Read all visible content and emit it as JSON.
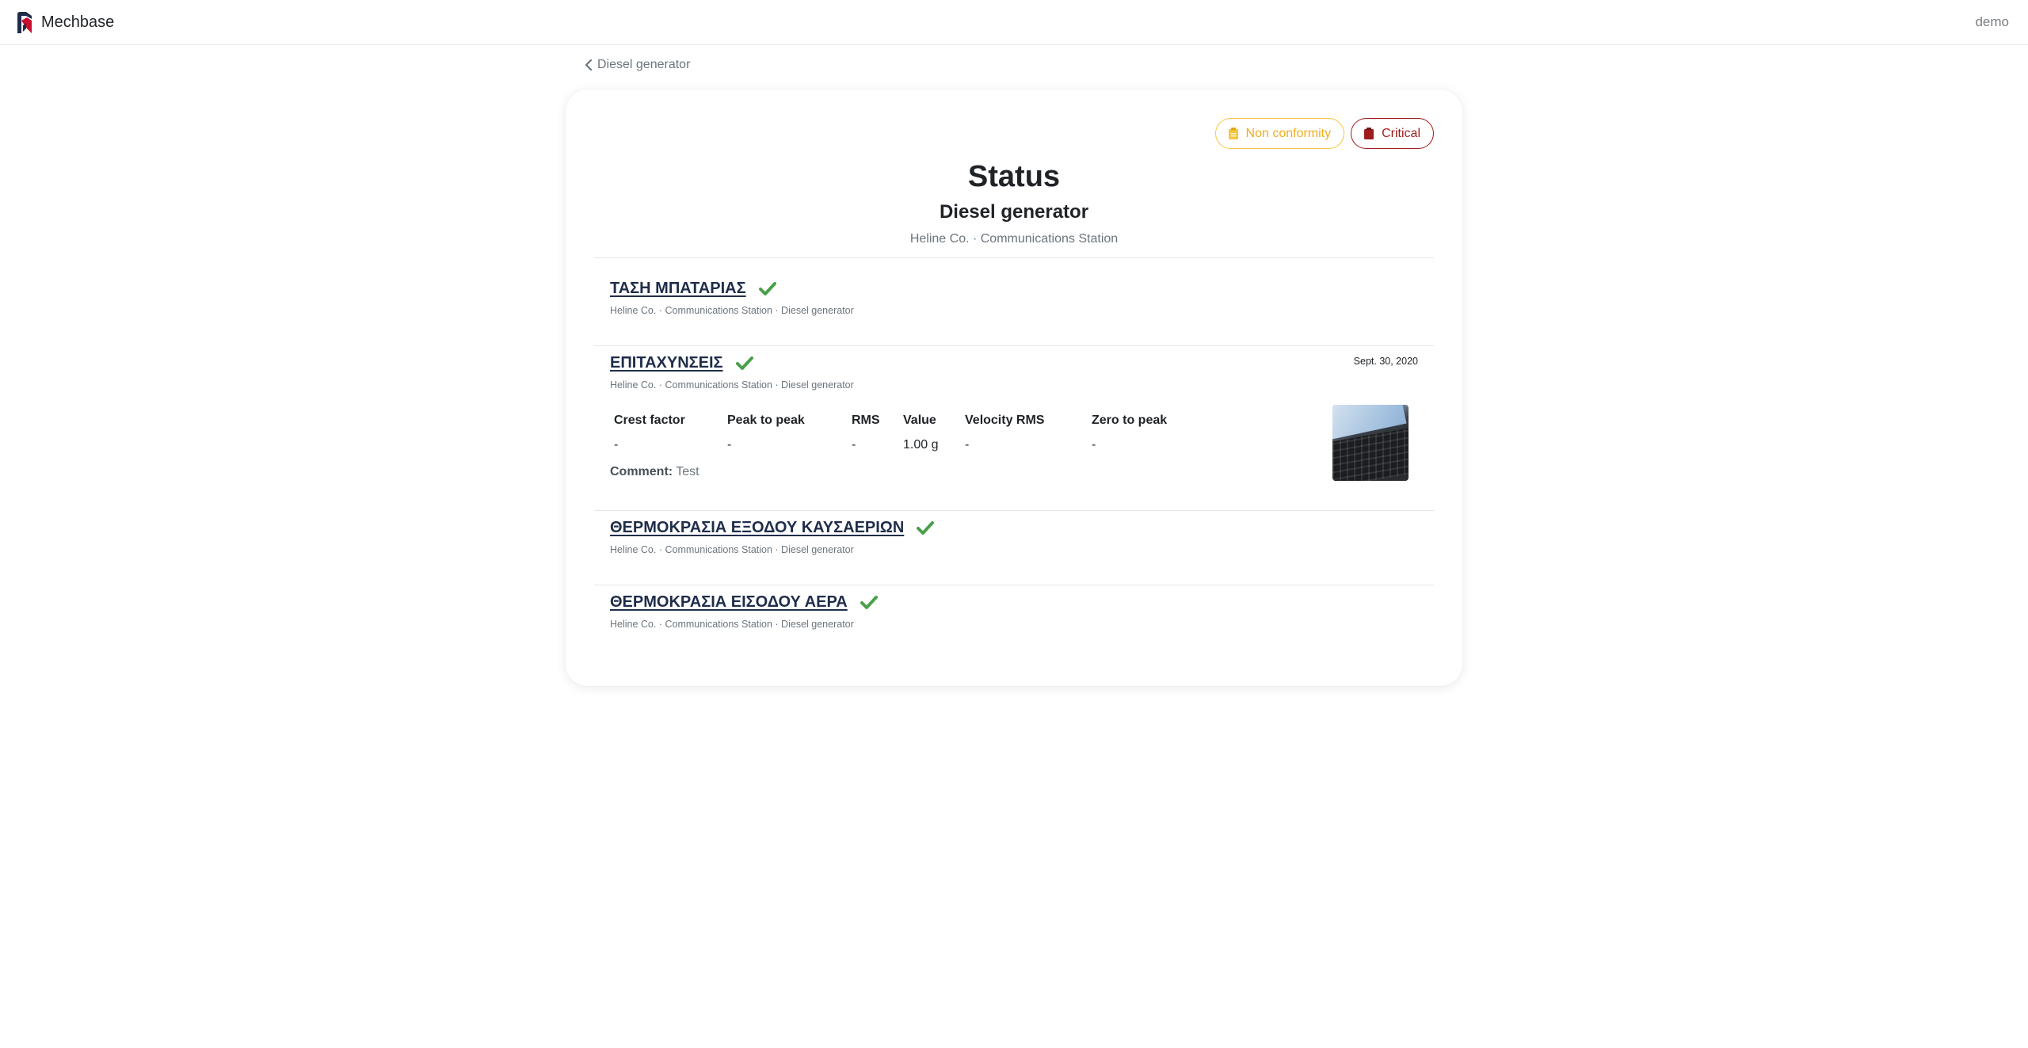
{
  "navbar": {
    "brand": "Mechbase",
    "user": "demo"
  },
  "breadcrumb": {
    "back_label": "Diesel generator"
  },
  "badges": {
    "non_conformity": "Non conformity",
    "critical": "Critical"
  },
  "header": {
    "title": "Status",
    "subtitle": "Diesel generator",
    "location": "Heline Co. · Communications Station"
  },
  "items": [
    {
      "title": "ΤΑΣΗ ΜΠΑΤΑΡΙΑΣ",
      "path": "Heline Co. · Communications Station · Diesel generator",
      "status": "ok"
    },
    {
      "title": "ΕΠΙΤΑΧΥΝΣΕΙΣ",
      "path": "Heline Co. · Communications Station · Diesel generator",
      "status": "ok",
      "date": "Sept. 30, 2020",
      "table": {
        "headers": [
          "Crest factor",
          "Peak to peak",
          "RMS",
          "Value",
          "Velocity RMS",
          "Zero to peak"
        ],
        "row": [
          "-",
          "-",
          "-",
          "1.00 g",
          "-",
          "-"
        ]
      },
      "comment_label": "Comment:",
      "comment": "Test"
    },
    {
      "title": "ΘΕΡΜΟΚΡΑΣΙΑ ΕΞΟΔΟΥ ΚΑΥΣΑΕΡΙΩΝ",
      "path": "Heline Co. · Communications Station · Diesel generator",
      "status": "ok"
    },
    {
      "title": "ΘΕΡΜΟΚΡΑΣΙΑ ΕΙΣΟΔΟΥ ΑΕΡΑ",
      "path": "Heline Co. · Communications Station · Diesel generator",
      "status": "ok"
    }
  ],
  "colors": {
    "check": "#4aa04a",
    "warning": "#f0ad1c",
    "danger": "#9f1c1c",
    "title_link": "#1f2d4a"
  }
}
